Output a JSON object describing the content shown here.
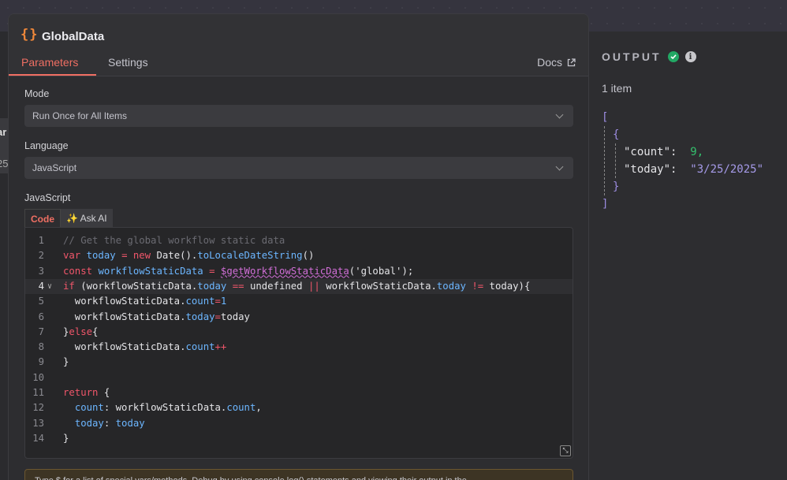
{
  "node": {
    "icon": "curly-braces-icon",
    "icon_text": "{}",
    "title": "GlobalData"
  },
  "tabs": {
    "parameters": "Parameters",
    "settings": "Settings",
    "docs": "Docs"
  },
  "fields": {
    "mode_label": "Mode",
    "mode_value": "Run Once for All Items",
    "language_label": "Language",
    "language_value": "JavaScript",
    "code_label": "JavaScript"
  },
  "code_tabs": {
    "code": "Code",
    "ask_ai": "✨ Ask AI"
  },
  "code_lines": [
    "// Get the global workflow static data",
    "var today = new Date().toLocaleDateString()",
    "const workflowStaticData = $getWorkflowStaticData('global');",
    "if (workflowStaticData.today == undefined || workflowStaticData.today != today){",
    "  workflowStaticData.count=1",
    "  workflowStaticData.today=today",
    "}else{",
    "  workflowStaticData.count++",
    "}",
    "",
    "return {",
    "  count: workflowStaticData.count,",
    "  today: today",
    "}"
  ],
  "current_line": 4,
  "hint": "Type $ for a list of special vars/methods. Debug by using console.log() statements and viewing their output in the",
  "output": {
    "title": "OUTPUT",
    "item_count": "1 item",
    "json": {
      "open_bracket": "[",
      "open_brace": "{",
      "count_key": "\"count\":",
      "count_value": "9,",
      "today_key": "\"today\":",
      "today_value": "\"3/25/2025\"",
      "close_brace": "}",
      "close_bracket": "]"
    }
  },
  "left_edge": {
    "text1": "ar",
    "text2": "25"
  },
  "colors": {
    "accent": "#f06f63",
    "success": "#22a864",
    "node_icon": "#f0883a"
  }
}
